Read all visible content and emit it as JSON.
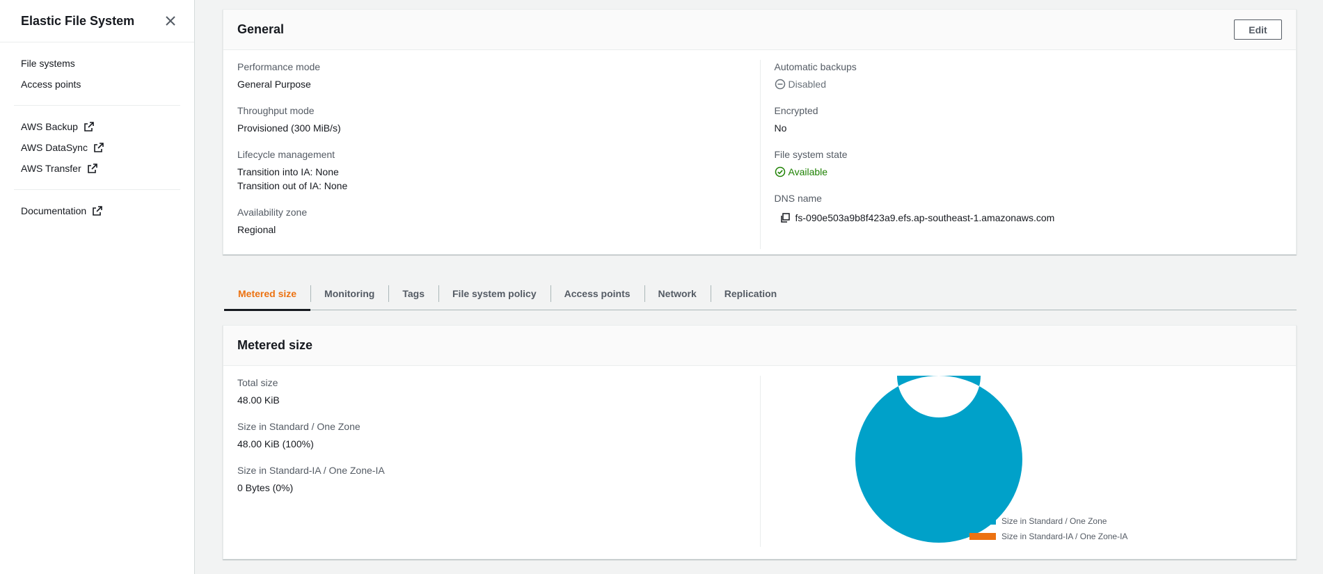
{
  "sidebar": {
    "title": "Elastic File System",
    "group1": [
      {
        "label": "File systems"
      },
      {
        "label": "Access points"
      }
    ],
    "group2": [
      {
        "label": "AWS Backup",
        "icon": "external-link-icon"
      },
      {
        "label": "AWS DataSync",
        "icon": "external-link-icon"
      },
      {
        "label": "AWS Transfer",
        "icon": "external-link-icon"
      }
    ],
    "group3": [
      {
        "label": "Documentation",
        "icon": "external-link-icon"
      }
    ]
  },
  "general": {
    "title": "General",
    "edit_label": "Edit",
    "left": {
      "performance_mode": {
        "label": "Performance mode",
        "value": "General Purpose"
      },
      "throughput_mode": {
        "label": "Throughput mode",
        "value": "Provisioned (300 MiB/s)"
      },
      "lifecycle": {
        "label": "Lifecycle management",
        "line1": "Transition into IA: None",
        "line2": "Transition out of IA: None"
      },
      "availability_zone": {
        "label": "Availability zone",
        "value": "Regional"
      }
    },
    "right": {
      "automatic_backups": {
        "label": "Automatic backups",
        "value": "Disabled"
      },
      "encrypted": {
        "label": "Encrypted",
        "value": "No"
      },
      "state": {
        "label": "File system state",
        "value": "Available"
      },
      "dns": {
        "label": "DNS name",
        "value": "fs-090e503a9b8f423a9.efs.ap-southeast-1.amazonaws.com"
      }
    }
  },
  "tabs": [
    {
      "label": "Metered size",
      "active": true
    },
    {
      "label": "Monitoring"
    },
    {
      "label": "Tags"
    },
    {
      "label": "File system policy"
    },
    {
      "label": "Access points"
    },
    {
      "label": "Network"
    },
    {
      "label": "Replication"
    }
  ],
  "metered": {
    "title": "Metered size",
    "total": {
      "label": "Total size",
      "value": "48.00 KiB"
    },
    "standard": {
      "label": "Size in Standard / One Zone",
      "value": "48.00 KiB (100%)"
    },
    "ia": {
      "label": "Size in Standard-IA / One Zone-IA",
      "value": "0 Bytes (0%)"
    }
  },
  "chart_data": {
    "type": "pie",
    "categories": [
      "Size in Standard / One Zone",
      "Size in Standard-IA / One Zone-IA"
    ],
    "values": [
      100,
      0
    ],
    "colors": [
      "#00a1c9",
      "#ec7211"
    ],
    "donut": true,
    "legend": "bottom-right"
  },
  "colors": {
    "accent": "#ec7211",
    "success": "#1d8102",
    "chart_blue": "#00a1c9"
  }
}
